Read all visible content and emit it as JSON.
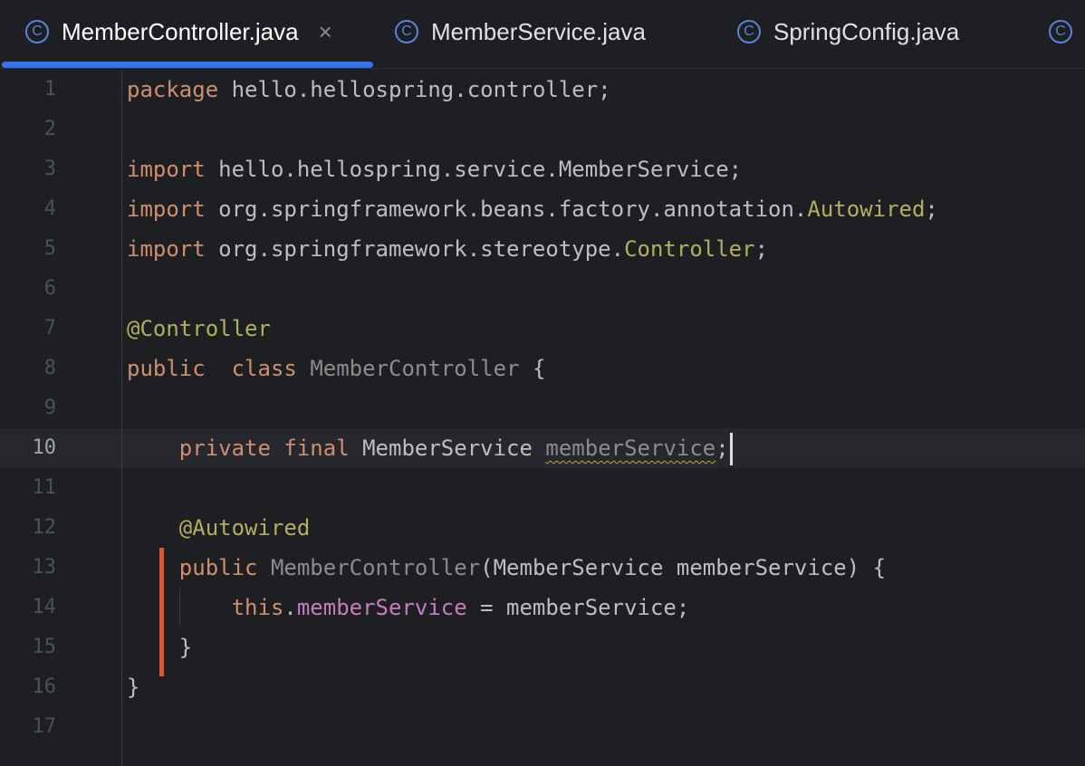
{
  "tabs": [
    {
      "label": "MemberController.java",
      "active": true,
      "closable": true,
      "icon": "class-c-icon"
    },
    {
      "label": "MemberService.java",
      "active": false,
      "icon": "class-c-icon"
    },
    {
      "label": "SpringConfig.java",
      "active": false,
      "icon": "class-c-icon"
    },
    {
      "label": "",
      "active": false,
      "icon": "class-c-icon"
    }
  ],
  "tab_icon_glyph": "C",
  "close_glyph": "×",
  "colors": {
    "accent": "#3574f0",
    "keyword": "#cf8e6d",
    "annotation": "#b3ae60",
    "field": "#c77dbb",
    "change_marker": "#e0552f"
  },
  "editor": {
    "current_line": 10,
    "lines": [
      {
        "n": "1",
        "tokens": [
          {
            "t": "package",
            "c": "kw"
          },
          {
            "t": " hello.hellospring.controller;"
          }
        ]
      },
      {
        "n": "2",
        "tokens": []
      },
      {
        "n": "3",
        "tokens": [
          {
            "t": "import",
            "c": "kw"
          },
          {
            "t": " hello.hellospring.service.MemberService;"
          }
        ]
      },
      {
        "n": "4",
        "tokens": [
          {
            "t": "import",
            "c": "kw"
          },
          {
            "t": " org.springframework.beans.factory.annotation."
          },
          {
            "t": "Autowired",
            "c": "type-yellow"
          },
          {
            "t": ";"
          }
        ]
      },
      {
        "n": "5",
        "tokens": [
          {
            "t": "import",
            "c": "kw"
          },
          {
            "t": " org.springframework.stereotype."
          },
          {
            "t": "Controller",
            "c": "type-yellow"
          },
          {
            "t": ";"
          }
        ]
      },
      {
        "n": "6",
        "tokens": []
      },
      {
        "n": "7",
        "tokens": [
          {
            "t": "@Controller",
            "c": "ann"
          }
        ]
      },
      {
        "n": "8",
        "tokens": [
          {
            "t": "public",
            "c": "kw"
          },
          {
            "t": "  "
          },
          {
            "t": "class",
            "c": "kw"
          },
          {
            "t": " "
          },
          {
            "t": "MemberController",
            "c": "cls-dim"
          },
          {
            "t": " {"
          }
        ]
      },
      {
        "n": "9",
        "tokens": []
      },
      {
        "n": "10",
        "tokens": [
          {
            "t": "    "
          },
          {
            "t": "private",
            "c": "kw"
          },
          {
            "t": " "
          },
          {
            "t": "final",
            "c": "kw"
          },
          {
            "t": " MemberService "
          },
          {
            "t": "memberService",
            "c": "unused"
          },
          {
            "t": ";"
          }
        ],
        "caret": true
      },
      {
        "n": "11",
        "tokens": []
      },
      {
        "n": "12",
        "tokens": [
          {
            "t": "    "
          },
          {
            "t": "@Autowired",
            "c": "ann"
          }
        ]
      },
      {
        "n": "13",
        "tokens": [
          {
            "t": "    "
          },
          {
            "t": "public",
            "c": "kw"
          },
          {
            "t": " "
          },
          {
            "t": "MemberController",
            "c": "cls-dim"
          },
          {
            "t": "(MemberService memberService) {"
          }
        ]
      },
      {
        "n": "14",
        "tokens": [
          {
            "t": "        "
          },
          {
            "t": "this",
            "c": "kw"
          },
          {
            "t": "."
          },
          {
            "t": "memberService",
            "c": "field"
          },
          {
            "t": " = memberService;"
          }
        ]
      },
      {
        "n": "15",
        "tokens": [
          {
            "t": "    }"
          }
        ]
      },
      {
        "n": "16",
        "tokens": [
          {
            "t": "}"
          }
        ]
      },
      {
        "n": "17",
        "tokens": []
      }
    ]
  }
}
